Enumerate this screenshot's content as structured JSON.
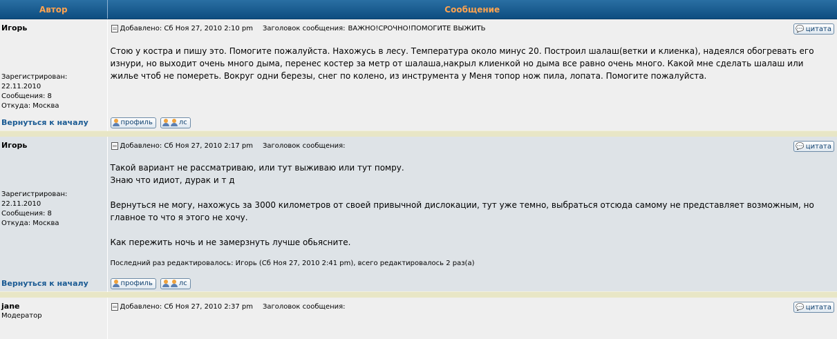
{
  "header": {
    "author_col": "Автор",
    "message_col": "Сообщение"
  },
  "posts": [
    {
      "author": "Игорь",
      "registered_label": "Зарегистрирован:",
      "registered_date": "22.11.2010",
      "posts_count": "Сообщения: 8",
      "location": "Откуда: Москва",
      "added": "Добавлено: Сб Ноя 27, 2010 2:10 pm",
      "subject_label": "Заголовок сообщения:",
      "subject": "ВАЖНО!СРОЧНО!ПОМОГИТЕ ВЫЖИТЬ",
      "quote_label": "цитата",
      "body": [
        "Стою у костра и пишу это. Помогите пожалуйста. Нахожусь в лесу. Температура около минус 20. Построил шалаш(ветки и клиенка), надеялся обогревать его изнури, но выходит очень много дыма, перенес костер за метр от шалаша,накрыл клиенкой но дыма все равно очень много. Какой мне сделать шалаш или жилье чтоб не помереть. Вокруг одни березы, снег по колено, из инструмента у Меня топор нож пила, лопата. Помогите пожалуйста."
      ],
      "back_link": "Вернуться к началу",
      "profile_label": "профиль",
      "pm_label": "лс"
    },
    {
      "author": "Игорь",
      "registered_label": "Зарегистрирован:",
      "registered_date": "22.11.2010",
      "posts_count": "Сообщения: 8",
      "location": "Откуда: Москва",
      "added": "Добавлено: Сб Ноя 27, 2010 2:17 pm",
      "subject_label": "Заголовок сообщения:",
      "subject": "",
      "quote_label": "цитата",
      "body": [
        "Такой вариант не рассматриваю, или тут выживаю или тут помру.",
        "Знаю что идиот, дурак и т д",
        "",
        "Вернуться не могу, нахожусь за 3000 километров от своей привычной дислокации, тут уже темно, выбраться отсюда самому не представляет возможным, но главное то что я этого не хочу.",
        "",
        "Как пережить ночь и не замерзнуть лучше обьясните."
      ],
      "edit_note": "Последний раз редактировалось: Игорь (Сб Ноя 27, 2010 2:41 pm), всего редактировалось 2 раз(а)",
      "back_link": "Вернуться к началу",
      "profile_label": "профиль",
      "pm_label": "лс"
    },
    {
      "author": "jane",
      "rank": "Модератор",
      "added": "Добавлено: Сб Ноя 27, 2010 2:37 pm",
      "subject_label": "Заголовок сообщения:",
      "subject": "",
      "quote_label": "цитата"
    }
  ]
}
